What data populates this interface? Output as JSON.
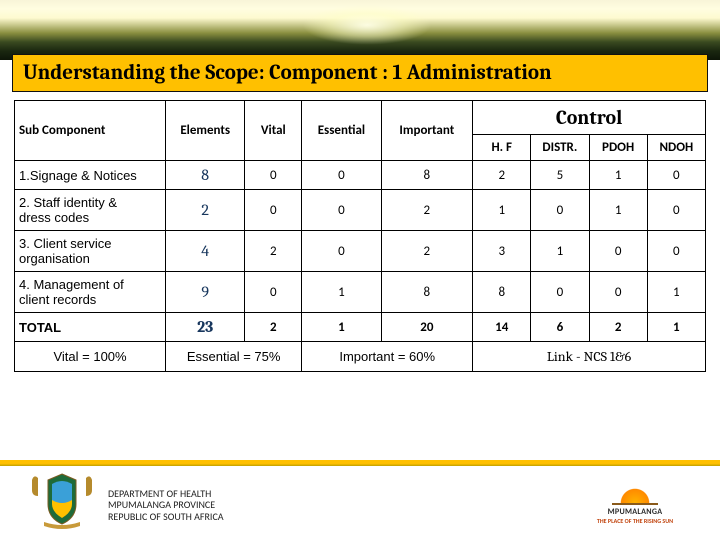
{
  "title": "Understanding the Scope:  Component : 1  Administration",
  "headers": {
    "sub": "Sub Component",
    "elem": "Elements",
    "vital": "Vital",
    "ess": "Essential",
    "imp": "Important",
    "control": "Control",
    "hf": "H. F",
    "distr": "DISTR.",
    "pdoh": "PDOH",
    "ndoh": "NDOH"
  },
  "rows": [
    {
      "name": "1.Signage & Notices",
      "elem": "8",
      "vital": "0",
      "ess": "0",
      "imp": "8",
      "hf": "2",
      "distr": "5",
      "pdoh": "1",
      "ndoh": "0"
    },
    {
      "name": "2. Staff identity &\n     dress codes",
      "elem": "2",
      "vital": "0",
      "ess": "0",
      "imp": "2",
      "hf": "1",
      "distr": "0",
      "pdoh": "1",
      "ndoh": "0"
    },
    {
      "name": "3. Client  service\n     organisation",
      "elem": "4",
      "vital": "2",
      "ess": "0",
      "imp": "2",
      "hf": "3",
      "distr": "1",
      "pdoh": "0",
      "ndoh": "0"
    },
    {
      "name": "4. Management of\n     client records",
      "elem": "9",
      "vital": "0",
      "ess": "1",
      "imp": "8",
      "hf": "8",
      "distr": "0",
      "pdoh": "0",
      "ndoh": "1"
    }
  ],
  "total": {
    "name": "TOTAL",
    "elem": "23",
    "vital": "2",
    "ess": "1",
    "imp": "20",
    "hf": "14",
    "distr": "6",
    "pdoh": "2",
    "ndoh": "1"
  },
  "footer": {
    "vital": "Vital = 100%",
    "ess": "Essential = 75%",
    "imp": "Important = 60%",
    "link": "Link -  NCS 1&6"
  },
  "dept": {
    "l1": "DEPARTMENT OF HEALTH",
    "l2": "MPUMALANGA PROVINCE",
    "l3": "REPUBLIC OF SOUTH AFRICA"
  },
  "prov": {
    "name": "MPUMALANGA",
    "tag": "THE PLACE OF THE RISING SUN"
  }
}
